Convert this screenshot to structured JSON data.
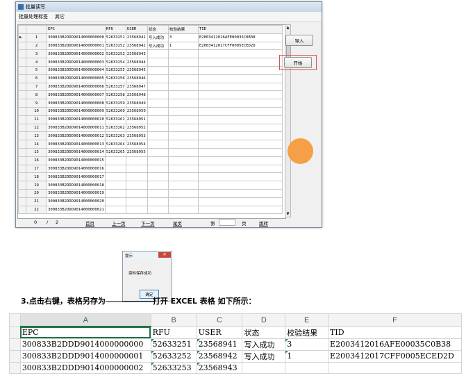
{
  "window": {
    "title": "批量读写",
    "menu": [
      "批量处理标签",
      "其它"
    ],
    "columns": [
      "",
      "",
      "EPC",
      "RFU",
      "USER",
      "状态",
      "校验结果",
      "TID"
    ],
    "rows": [
      {
        "idx": "1",
        "epc": "300833B2DDD9014000000000",
        "rfu": "52633251",
        "user": "23568941",
        "status": "写入成功",
        "check": "3",
        "tid": "E2003412016AFE00035C0B38"
      },
      {
        "idx": "2",
        "epc": "300833B2DDD9014000000001",
        "rfu": "52633252",
        "user": "23568942",
        "status": "写入成功",
        "check": "1",
        "tid": "E2003412017CFF0005ECED2D"
      },
      {
        "idx": "3",
        "epc": "300833B2DDD9014000000002",
        "rfu": "52633253",
        "user": "23568943",
        "status": "",
        "check": "",
        "tid": ""
      },
      {
        "idx": "4",
        "epc": "300833B2DDD9014000000003",
        "rfu": "52633254",
        "user": "23568944",
        "status": "",
        "check": "",
        "tid": ""
      },
      {
        "idx": "5",
        "epc": "300833B2DDD9014000000004",
        "rfu": "52633255",
        "user": "23568945",
        "status": "",
        "check": "",
        "tid": ""
      },
      {
        "idx": "6",
        "epc": "300833B2DDD9014000000005",
        "rfu": "52633256",
        "user": "23568946",
        "status": "",
        "check": "",
        "tid": ""
      },
      {
        "idx": "7",
        "epc": "300833B2DDD9014000000006",
        "rfu": "52633257",
        "user": "23568947",
        "status": "",
        "check": "",
        "tid": ""
      },
      {
        "idx": "8",
        "epc": "300833B2DDD9014000000007",
        "rfu": "52633258",
        "user": "23568948",
        "status": "",
        "check": "",
        "tid": ""
      },
      {
        "idx": "9",
        "epc": "300833B2DDD9014000000008",
        "rfu": "52633259",
        "user": "23568949",
        "status": "",
        "check": "",
        "tid": ""
      },
      {
        "idx": "10",
        "epc": "300833B2DDD9014000000009",
        "rfu": "52633260",
        "user": "23568950",
        "status": "",
        "check": "",
        "tid": ""
      },
      {
        "idx": "11",
        "epc": "300833B2DDD9014000000010",
        "rfu": "52633261",
        "user": "23568951",
        "status": "",
        "check": "",
        "tid": ""
      },
      {
        "idx": "12",
        "epc": "300833B2DDD9014000000011",
        "rfu": "52633262",
        "user": "23568952",
        "status": "",
        "check": "",
        "tid": ""
      },
      {
        "idx": "13",
        "epc": "300833B2DDD9014000000012",
        "rfu": "52633263",
        "user": "23568953",
        "status": "",
        "check": "",
        "tid": ""
      },
      {
        "idx": "14",
        "epc": "300833B2DDD9014000000013",
        "rfu": "52633264",
        "user": "23568954",
        "status": "",
        "check": "",
        "tid": ""
      },
      {
        "idx": "15",
        "epc": "300833B2DDD9014000000014",
        "rfu": "52633265",
        "user": "23568955",
        "status": "",
        "check": "",
        "tid": ""
      },
      {
        "idx": "16",
        "epc": "300833B2DDD9014000000015",
        "rfu": "",
        "user": "",
        "status": "",
        "check": "",
        "tid": ""
      },
      {
        "idx": "17",
        "epc": "300833B2DDD9014000000016",
        "rfu": "",
        "user": "",
        "status": "",
        "check": "",
        "tid": ""
      },
      {
        "idx": "18",
        "epc": "300833B2DDD9014000000017",
        "rfu": "",
        "user": "",
        "status": "",
        "check": "",
        "tid": ""
      },
      {
        "idx": "19",
        "epc": "300833B2DDD9014000000018",
        "rfu": "",
        "user": "",
        "status": "",
        "check": "",
        "tid": ""
      },
      {
        "idx": "20",
        "epc": "300833B2DDD9014000000019",
        "rfu": "",
        "user": "",
        "status": "",
        "check": "",
        "tid": ""
      },
      {
        "idx": "21",
        "epc": "300833B2DDD9014000000020",
        "rfu": "",
        "user": "",
        "status": "",
        "check": "",
        "tid": ""
      },
      {
        "idx": "22",
        "epc": "300833B2DDD9014000000021",
        "rfu": "",
        "user": "",
        "status": "",
        "check": "",
        "tid": ""
      }
    ],
    "buttons": {
      "import": "导入",
      "start": "开始"
    },
    "footer": {
      "current_page": "0",
      "separator": "/",
      "total_pages": "2",
      "first": "首页",
      "prev": "上一页",
      "next": "下一页",
      "last": "尾页",
      "page_prefix": "第",
      "page_suffix": "页",
      "goto": "跳转"
    }
  },
  "dialog": {
    "title": "提示",
    "close": "✕",
    "message": "资料保存成功",
    "ok": "确定"
  },
  "caption": {
    "before": "3.点击右键，表格另存为",
    "after": "打开 EXCEL 表格 如下所示："
  },
  "excel": {
    "col_letters": [
      "A",
      "B",
      "C",
      "D",
      "E",
      "F"
    ],
    "header_row": [
      "EPC",
      "RFU",
      "USER",
      "状态",
      "校验结果",
      "TID"
    ],
    "rows": [
      [
        "300833B2DDD9014000000000",
        "52633251",
        "23568941",
        "写入成功",
        "3",
        "E2003412016AFE00035C0B38"
      ],
      [
        "300833B2DDD9014000000001",
        "52633252",
        "23568942",
        "写入成功",
        "1",
        "E2003412017CFF0005ECED2D"
      ],
      [
        "300833B2DDD9014000000002",
        "52633253",
        "23568943",
        "",
        "",
        ""
      ]
    ]
  },
  "colors": {
    "accent_orange": "#f5a047",
    "highlight_red": "#d9534f",
    "excel_green": "#217346"
  }
}
